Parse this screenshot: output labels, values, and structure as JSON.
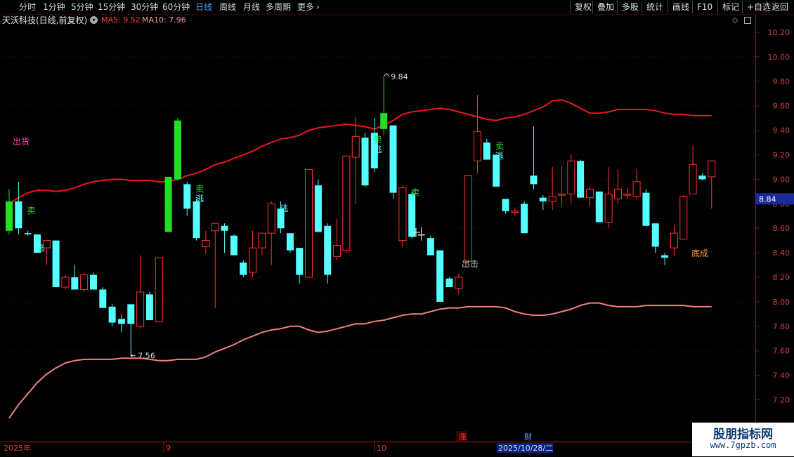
{
  "toolbar": {
    "periods": [
      "分时",
      "1分钟",
      "5分钟",
      "15分钟",
      "30分钟",
      "60分钟",
      "日线",
      "周线",
      "月线",
      "多周期",
      "更多"
    ],
    "active_period": "日线",
    "right_buttons": [
      "复权",
      "叠加",
      "多股",
      "统计",
      "画线",
      "F10",
      "标记",
      "+自选",
      "返回"
    ]
  },
  "info": {
    "title": "天沃科技(日线,前复权)",
    "ma5_label": "MA5: 9.52",
    "ma10_label": "MA10: 7.96"
  },
  "chart_data": {
    "type": "candlestick",
    "y_ticks": [
      "10.20",
      "10.00",
      "9.80",
      "9.60",
      "9.40",
      "9.20",
      "9.00",
      "8.80",
      "8.60",
      "8.40",
      "8.20",
      "8.00",
      "7.80",
      "7.60",
      "7.40",
      "7.20"
    ],
    "ylim": [
      7.1,
      10.32
    ],
    "current_price_label": "8.84",
    "high_marker": "9.84",
    "low_marker": "7.56",
    "x_labels": [
      "2025年",
      "9",
      "10"
    ],
    "cursor_date": "2025/10/28/二",
    "event_markers": [
      "涨",
      "财"
    ],
    "candles": [
      {
        "o": 8.58,
        "h": 8.92,
        "l": 8.55,
        "c": 8.82,
        "color": "green"
      },
      {
        "o": 8.82,
        "h": 8.98,
        "l": 8.55,
        "c": 8.6,
        "color": "cyan"
      },
      {
        "o": 8.56,
        "h": 8.58,
        "l": 8.54,
        "c": 8.56,
        "color": "cyan"
      },
      {
        "o": 8.55,
        "h": 8.55,
        "l": 8.4,
        "c": 8.4,
        "color": "cyan"
      },
      {
        "o": 8.44,
        "h": 8.5,
        "l": 8.3,
        "c": 8.5,
        "color": "red"
      },
      {
        "o": 8.5,
        "h": 8.5,
        "l": 8.12,
        "c": 8.12,
        "color": "cyan"
      },
      {
        "o": 8.12,
        "h": 8.22,
        "l": 8.1,
        "c": 8.2,
        "color": "red"
      },
      {
        "o": 8.2,
        "h": 8.3,
        "l": 8.1,
        "c": 8.1,
        "color": "cyan"
      },
      {
        "o": 8.1,
        "h": 8.24,
        "l": 8.08,
        "c": 8.22,
        "color": "red"
      },
      {
        "o": 8.22,
        "h": 8.24,
        "l": 8.1,
        "c": 8.1,
        "color": "cyan"
      },
      {
        "o": 8.1,
        "h": 8.12,
        "l": 7.95,
        "c": 7.95,
        "color": "cyan"
      },
      {
        "o": 7.96,
        "h": 7.98,
        "l": 7.8,
        "c": 7.83,
        "color": "cyan"
      },
      {
        "o": 7.86,
        "h": 7.9,
        "l": 7.75,
        "c": 7.82,
        "color": "cyan"
      },
      {
        "o": 7.82,
        "h": 7.98,
        "l": 7.56,
        "c": 7.98,
        "color": "cyan"
      },
      {
        "o": 7.8,
        "h": 8.38,
        "l": 7.78,
        "c": 8.08,
        "color": "red"
      },
      {
        "o": 8.06,
        "h": 8.08,
        "l": 7.85,
        "c": 7.85,
        "color": "cyan"
      },
      {
        "o": 7.84,
        "h": 8.36,
        "l": 7.84,
        "c": 8.36,
        "color": "red"
      },
      {
        "o": 8.57,
        "h": 9.02,
        "l": 8.57,
        "c": 9.02,
        "color": "green"
      },
      {
        "o": 9.0,
        "h": 9.5,
        "l": 8.99,
        "c": 9.48,
        "color": "green"
      },
      {
        "o": 8.96,
        "h": 8.98,
        "l": 8.7,
        "c": 8.76,
        "color": "cyan"
      },
      {
        "o": 8.82,
        "h": 8.84,
        "l": 8.5,
        "c": 8.52,
        "color": "cyan"
      },
      {
        "o": 8.5,
        "h": 8.58,
        "l": 8.39,
        "c": 8.45,
        "color": "red"
      },
      {
        "o": 8.58,
        "h": 8.62,
        "l": 7.95,
        "c": 8.64,
        "color": "red"
      },
      {
        "o": 8.62,
        "h": 8.64,
        "l": 8.4,
        "c": 8.58,
        "color": "cyan"
      },
      {
        "o": 8.54,
        "h": 8.55,
        "l": 8.38,
        "c": 8.38,
        "color": "cyan"
      },
      {
        "o": 8.32,
        "h": 8.34,
        "l": 8.2,
        "c": 8.22,
        "color": "cyan"
      },
      {
        "o": 8.24,
        "h": 8.58,
        "l": 8.2,
        "c": 8.44,
        "color": "red"
      },
      {
        "o": 8.44,
        "h": 8.56,
        "l": 8.38,
        "c": 8.56,
        "color": "red"
      },
      {
        "o": 8.56,
        "h": 8.82,
        "l": 8.3,
        "c": 8.8,
        "color": "red"
      },
      {
        "o": 8.76,
        "h": 8.82,
        "l": 8.56,
        "c": 8.6,
        "color": "cyan"
      },
      {
        "o": 8.56,
        "h": 8.56,
        "l": 8.4,
        "c": 8.42,
        "color": "cyan"
      },
      {
        "o": 8.44,
        "h": 8.44,
        "l": 8.15,
        "c": 8.22,
        "color": "cyan"
      },
      {
        "o": 8.2,
        "h": 9.08,
        "l": 8.2,
        "c": 9.08,
        "color": "red"
      },
      {
        "o": 8.95,
        "h": 9.0,
        "l": 8.57,
        "c": 8.57,
        "color": "cyan"
      },
      {
        "o": 8.62,
        "h": 8.64,
        "l": 8.15,
        "c": 8.22,
        "color": "cyan"
      },
      {
        "o": 8.37,
        "h": 8.68,
        "l": 8.34,
        "c": 8.46,
        "color": "red"
      },
      {
        "o": 8.42,
        "h": 9.18,
        "l": 8.4,
        "c": 9.19,
        "color": "red"
      },
      {
        "o": 9.18,
        "h": 9.51,
        "l": 8.8,
        "c": 9.35,
        "color": "red"
      },
      {
        "o": 9.34,
        "h": 9.38,
        "l": 8.94,
        "c": 8.95,
        "color": "cyan"
      },
      {
        "o": 9.38,
        "h": 9.5,
        "l": 9.06,
        "c": 9.09,
        "color": "cyan"
      },
      {
        "o": 9.41,
        "h": 9.84,
        "l": 9.36,
        "c": 9.54,
        "color": "green"
      },
      {
        "o": 9.44,
        "h": 9.44,
        "l": 8.84,
        "c": 8.89,
        "color": "cyan"
      },
      {
        "o": 8.93,
        "h": 8.95,
        "l": 8.45,
        "c": 8.5,
        "color": "red"
      },
      {
        "o": 8.88,
        "h": 8.9,
        "l": 8.52,
        "c": 8.53,
        "color": "cyan"
      },
      {
        "o": 8.55,
        "h": 8.61,
        "l": 8.5,
        "c": 8.55,
        "color": "white"
      },
      {
        "o": 8.52,
        "h": 8.54,
        "l": 8.38,
        "c": 8.38,
        "color": "cyan"
      },
      {
        "o": 8.42,
        "h": 8.42,
        "l": 8.0,
        "c": 8.0,
        "color": "cyan"
      },
      {
        "o": 8.19,
        "h": 8.2,
        "l": 8.12,
        "c": 8.12,
        "color": "cyan"
      },
      {
        "o": 8.11,
        "h": 8.23,
        "l": 8.06,
        "c": 8.2,
        "color": "red"
      },
      {
        "o": 8.33,
        "h": 9.03,
        "l": 8.3,
        "c": 9.03,
        "color": "red"
      },
      {
        "o": 9.15,
        "h": 9.69,
        "l": 9.05,
        "c": 9.39,
        "color": "red"
      },
      {
        "o": 9.3,
        "h": 9.33,
        "l": 9.16,
        "c": 9.16,
        "color": "cyan"
      },
      {
        "o": 9.2,
        "h": 9.2,
        "l": 8.94,
        "c": 8.94,
        "color": "cyan"
      },
      {
        "o": 8.84,
        "h": 8.84,
        "l": 8.72,
        "c": 8.74,
        "color": "cyan"
      },
      {
        "o": 8.74,
        "h": 8.77,
        "l": 8.7,
        "c": 8.73,
        "color": "red"
      },
      {
        "o": 8.8,
        "h": 8.82,
        "l": 8.56,
        "c": 8.56,
        "color": "cyan"
      },
      {
        "o": 9.03,
        "h": 9.43,
        "l": 8.92,
        "c": 8.96,
        "color": "cyan"
      },
      {
        "o": 8.85,
        "h": 8.87,
        "l": 8.75,
        "c": 8.82,
        "color": "cyan"
      },
      {
        "o": 8.82,
        "h": 9.1,
        "l": 8.75,
        "c": 8.86,
        "color": "red"
      },
      {
        "o": 8.87,
        "h": 9.11,
        "l": 8.78,
        "c": 8.88,
        "color": "red"
      },
      {
        "o": 8.88,
        "h": 9.2,
        "l": 8.8,
        "c": 9.15,
        "color": "red"
      },
      {
        "o": 9.15,
        "h": 9.16,
        "l": 8.85,
        "c": 8.85,
        "color": "cyan"
      },
      {
        "o": 8.92,
        "h": 8.94,
        "l": 8.78,
        "c": 8.85,
        "color": "red"
      },
      {
        "o": 8.9,
        "h": 8.9,
        "l": 8.65,
        "c": 8.65,
        "color": "cyan"
      },
      {
        "o": 8.65,
        "h": 9.1,
        "l": 8.6,
        "c": 8.88,
        "color": "red"
      },
      {
        "o": 8.84,
        "h": 9.08,
        "l": 8.8,
        "c": 8.92,
        "color": "red"
      },
      {
        "o": 8.87,
        "h": 8.93,
        "l": 8.84,
        "c": 8.88,
        "color": "red"
      },
      {
        "o": 8.86,
        "h": 9.08,
        "l": 8.84,
        "c": 8.98,
        "color": "red"
      },
      {
        "o": 8.89,
        "h": 8.92,
        "l": 8.62,
        "c": 8.62,
        "color": "cyan"
      },
      {
        "o": 8.64,
        "h": 8.64,
        "l": 8.4,
        "c": 8.45,
        "color": "cyan"
      },
      {
        "o": 8.38,
        "h": 8.4,
        "l": 8.3,
        "c": 8.36,
        "color": "cyan"
      },
      {
        "o": 8.44,
        "h": 8.63,
        "l": 8.37,
        "c": 8.56,
        "color": "red"
      },
      {
        "o": 8.51,
        "h": 8.87,
        "l": 8.51,
        "c": 8.86,
        "color": "red"
      },
      {
        "o": 8.88,
        "h": 9.28,
        "l": 8.88,
        "c": 9.12,
        "color": "red"
      },
      {
        "o": 9.03,
        "h": 9.05,
        "l": 8.99,
        "c": 9.0,
        "color": "cyan"
      },
      {
        "o": 9.02,
        "h": 9.15,
        "l": 8.76,
        "c": 9.15,
        "color": "red"
      }
    ],
    "upper_band": [
      8.8,
      8.85,
      8.89,
      8.91,
      8.91,
      8.9,
      8.91,
      8.93,
      8.96,
      8.98,
      8.99,
      9.0,
      9.0,
      8.99,
      8.99,
      8.99,
      8.98,
      8.98,
      9.0,
      9.03,
      9.05,
      9.08,
      9.12,
      9.14,
      9.17,
      9.2,
      9.23,
      9.27,
      9.3,
      9.33,
      9.34,
      9.36,
      9.4,
      9.42,
      9.43,
      9.44,
      9.45,
      9.44,
      9.43,
      9.41,
      9.44,
      9.48,
      9.53,
      9.55,
      9.56,
      9.57,
      9.58,
      9.57,
      9.55,
      9.53,
      9.51,
      9.49,
      9.48,
      9.5,
      9.51,
      9.53,
      9.56,
      9.59,
      9.64,
      9.65,
      9.62,
      9.58,
      9.54,
      9.54,
      9.55,
      9.57,
      9.57,
      9.57,
      9.57,
      9.56,
      9.54,
      9.53,
      9.53,
      9.52,
      9.52,
      9.52
    ],
    "lower_band": [
      7.05,
      7.16,
      7.25,
      7.34,
      7.41,
      7.46,
      7.5,
      7.52,
      7.53,
      7.53,
      7.53,
      7.53,
      7.54,
      7.54,
      7.54,
      7.53,
      7.52,
      7.52,
      7.53,
      7.53,
      7.53,
      7.55,
      7.59,
      7.62,
      7.65,
      7.69,
      7.72,
      7.75,
      7.77,
      7.78,
      7.8,
      7.8,
      7.77,
      7.75,
      7.76,
      7.78,
      7.8,
      7.82,
      7.82,
      7.84,
      7.85,
      7.87,
      7.89,
      7.9,
      7.9,
      7.92,
      7.94,
      7.95,
      7.95,
      7.96,
      7.96,
      7.96,
      7.96,
      7.95,
      7.92,
      7.9,
      7.89,
      7.89,
      7.9,
      7.92,
      7.94,
      7.97,
      7.99,
      7.99,
      7.97,
      7.96,
      7.96,
      7.96,
      7.97,
      7.97,
      7.97,
      7.97,
      7.97,
      7.96,
      7.96,
      7.96
    ],
    "signals": [
      {
        "i": 1,
        "text": "卖",
        "pos": "above-low",
        "color": "#2ee02e"
      },
      {
        "i": 2,
        "text": "逃",
        "pos": "below",
        "color": "#60ffff"
      },
      {
        "i": 19,
        "text": "卖",
        "pos": "above",
        "color": "#2ee02e"
      },
      {
        "i": 19,
        "text": "逃",
        "pos": "mid",
        "color": "#60ffff"
      },
      {
        "i": 28,
        "text": "逃",
        "pos": "above",
        "color": "#60ffff"
      },
      {
        "i": 38,
        "text": "卖",
        "pos": "above",
        "color": "#2ee02e"
      },
      {
        "i": 38,
        "text": "逃",
        "pos": "mid",
        "color": "#60ffff"
      },
      {
        "i": 42,
        "text": "卖",
        "pos": "above",
        "color": "#2ee02e"
      },
      {
        "i": 51,
        "text": "卖",
        "pos": "above",
        "color": "#2ee02e"
      },
      {
        "i": 51,
        "text": "逃",
        "pos": "mid",
        "color": "#60ffff"
      }
    ],
    "annotations": [
      {
        "text": "出货",
        "color": "#ff44bb"
      },
      {
        "text": "出击",
        "color": "#bbbbbb"
      },
      {
        "text": "底成",
        "color": "#ff9a3c"
      }
    ]
  },
  "watermark": {
    "title": "股朋指标网",
    "url": "www.7gpzb.com"
  },
  "colors": {
    "up": "#ff3232",
    "down": "#54ffff",
    "strong": "#20e020",
    "axis": "#c00000",
    "upper_band": "#e81818",
    "lower_band": "#f08080"
  }
}
